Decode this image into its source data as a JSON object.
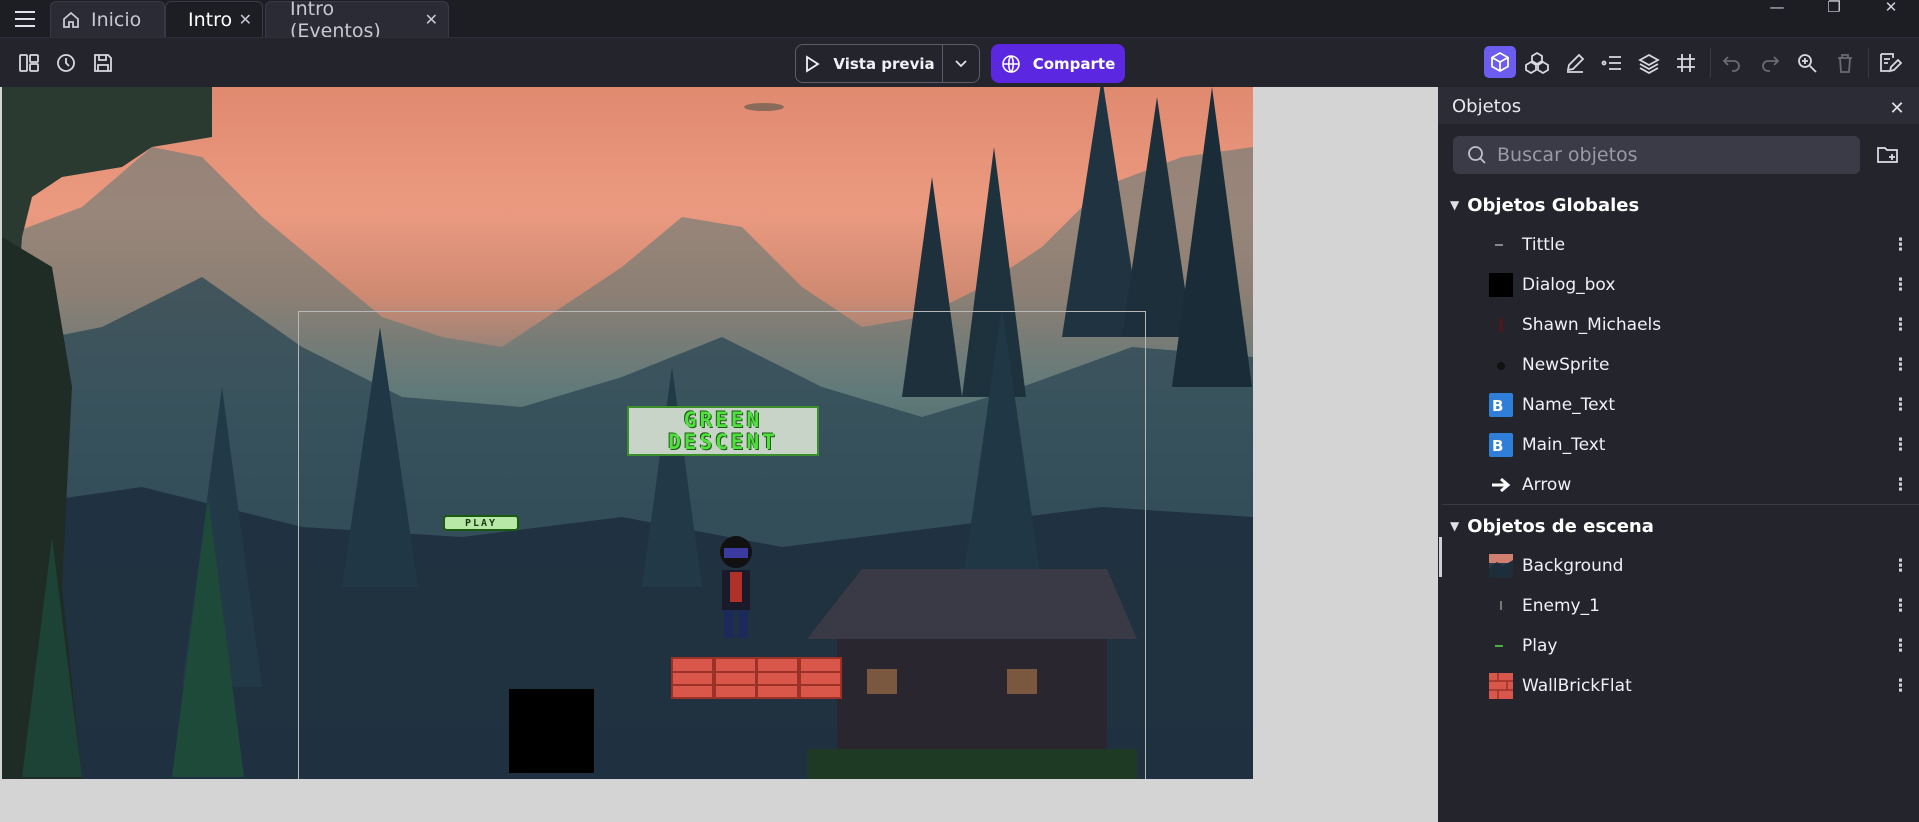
{
  "tabs": [
    {
      "label": "Inicio",
      "icon": "home-icon"
    },
    {
      "label": "Intro"
    },
    {
      "label": "Intro (Eventos)"
    }
  ],
  "toolbar": {
    "preview_label": "Vista previa",
    "share_label": "Comparte",
    "accent": "#5b27e0"
  },
  "scene": {
    "title_line1": "GREEN",
    "title_line2": "DESCENT",
    "play_label": "PLAY"
  },
  "panel": {
    "title": "Objetos",
    "search_placeholder": "Buscar objetos",
    "global_group": "Objetos Globales",
    "global_objects": [
      {
        "name": "Tittle",
        "icon": "text-icon"
      },
      {
        "name": "Dialog_box",
        "icon": "black-square-icon"
      },
      {
        "name": "Shawn_Michaels",
        "icon": "character-icon"
      },
      {
        "name": "NewSprite",
        "icon": "sprite-icon"
      },
      {
        "name": "Name_Text",
        "icon": "bitmap-text-icon"
      },
      {
        "name": "Main_Text",
        "icon": "bitmap-text-icon"
      },
      {
        "name": "Arrow",
        "icon": "arrow-right-icon"
      }
    ],
    "scene_group": "Objetos de escena",
    "scene_objects": [
      {
        "name": "Background",
        "icon": "background-icon"
      },
      {
        "name": "Enemy_1",
        "icon": "enemy-icon"
      },
      {
        "name": "Play",
        "icon": "play-sprite-icon"
      },
      {
        "name": "WallBrickFlat",
        "icon": "brick-icon"
      }
    ]
  }
}
